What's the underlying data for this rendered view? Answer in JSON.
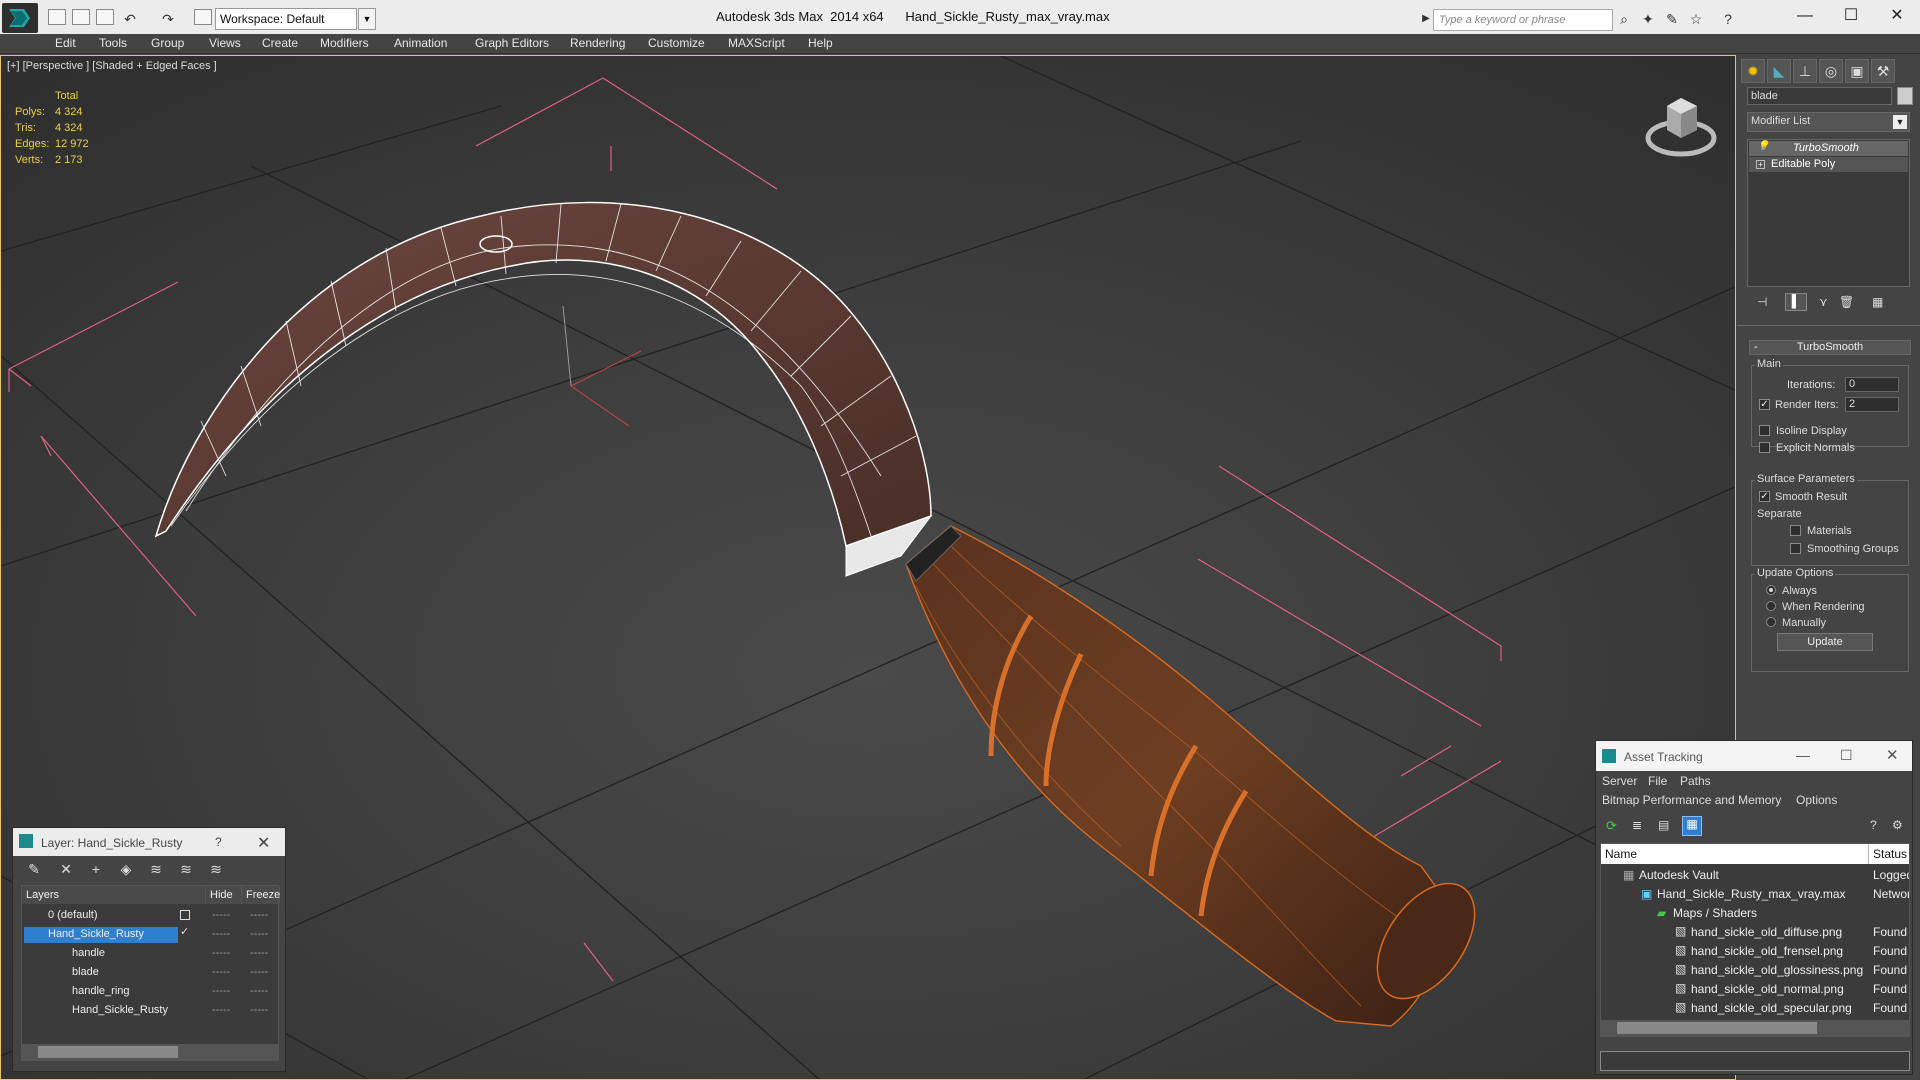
{
  "titlebar": {
    "workspace": "Workspace: Default",
    "app_title": "Autodesk 3ds Max  2014 x64",
    "file_title": "Hand_Sickle_Rusty_max_vray.max",
    "search_placeholder": "Type a keyword or phrase"
  },
  "menu": [
    "Edit",
    "Tools",
    "Group",
    "Views",
    "Create",
    "Modifiers",
    "Animation",
    "Graph Editors",
    "Rendering",
    "Customize",
    "MAXScript",
    "Help"
  ],
  "viewport": {
    "label": "[+] [Perspective ] [Shaded + Edged Faces ]",
    "stats_header": "Total",
    "stats": [
      {
        "label": "Polys:",
        "value": "4 324"
      },
      {
        "label": "Tris:",
        "value": "4 324"
      },
      {
        "label": "Edges:",
        "value": "12 972"
      },
      {
        "label": "Verts:",
        "value": "2 173"
      }
    ]
  },
  "command_panel": {
    "object_name": "blade",
    "modifier_list": "Modifier List",
    "stack": [
      "TurboSmooth",
      "Editable Poly"
    ],
    "rollout_title": "TurboSmooth",
    "main_group": "Main",
    "iterations_label": "Iterations:",
    "iterations_value": "0",
    "render_iters_label": "Render Iters:",
    "render_iters_value": "2",
    "isoline": "Isoline Display",
    "explicit_normals": "Explicit Normals",
    "surface_group": "Surface Parameters",
    "smooth_result": "Smooth Result",
    "separate": "Separate",
    "materials": "Materials",
    "smoothing_groups": "Smoothing Groups",
    "update_group": "Update Options",
    "always": "Always",
    "when_rendering": "When Rendering",
    "manually": "Manually",
    "update_btn": "Update"
  },
  "layer_dialog": {
    "title": "Layer: Hand_Sickle_Rusty",
    "help": "?",
    "col_layers": "Layers",
    "col_hide": "Hide",
    "col_freeze": "Freeze",
    "rows": [
      {
        "name": "0 (default)",
        "hide": "-----",
        "freeze": "-----"
      },
      {
        "name": "Hand_Sickle_Rusty",
        "hide": "-----",
        "freeze": "-----"
      },
      {
        "name": "handle",
        "hide": "-----",
        "freeze": "-----"
      },
      {
        "name": "blade",
        "hide": "-----",
        "freeze": "-----"
      },
      {
        "name": "handle_ring",
        "hide": "-----",
        "freeze": "-----"
      },
      {
        "name": "Hand_Sickle_Rusty",
        "hide": "-----",
        "freeze": "-----"
      }
    ]
  },
  "asset_dialog": {
    "title": "Asset Tracking",
    "menu1": [
      "Server",
      "File",
      "Paths"
    ],
    "menu2": [
      "Bitmap Performance and Memory",
      "Options"
    ],
    "col_name": "Name",
    "col_status": "Status",
    "rows": [
      {
        "name": "Autodesk Vault",
        "status": "Logged"
      },
      {
        "name": "Hand_Sickle_Rusty_max_vray.max",
        "status": "Networ"
      },
      {
        "name": "Maps / Shaders",
        "status": ""
      },
      {
        "name": "hand_sickle_old_diffuse.png",
        "status": "Found"
      },
      {
        "name": "hand_sickle_old_frensel.png",
        "status": "Found"
      },
      {
        "name": "hand_sickle_old_glossiness.png",
        "status": "Found"
      },
      {
        "name": "hand_sickle_old_normal.png",
        "status": "Found"
      },
      {
        "name": "hand_sickle_old_specular.png",
        "status": "Found"
      }
    ]
  }
}
